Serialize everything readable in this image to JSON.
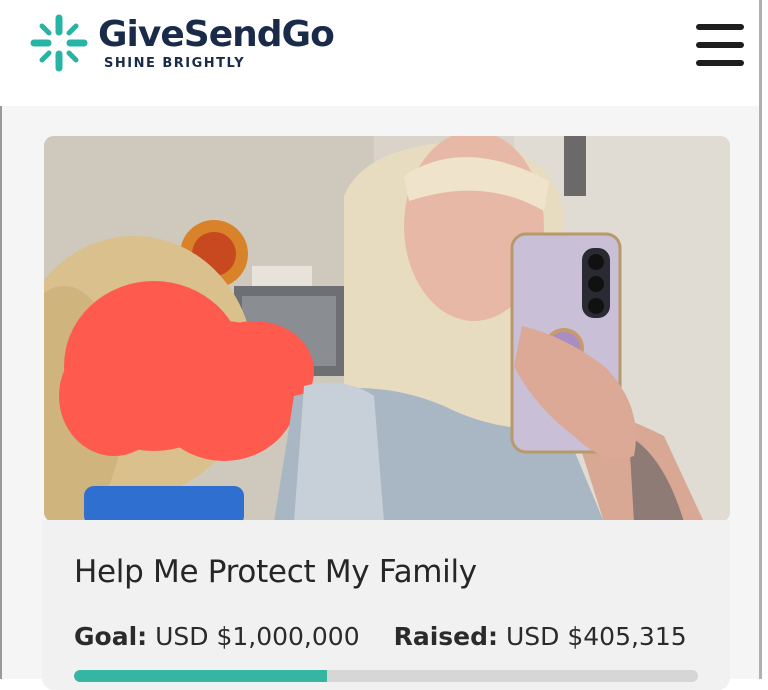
{
  "brand": {
    "name": "GiveSendGo",
    "tagline": "SHINE BRIGHTLY",
    "accent_color": "#27b4a5",
    "text_color": "#1a2b4a"
  },
  "header": {
    "menu_icon": "hamburger-menu-icon"
  },
  "campaign": {
    "title": "Help Me Protect My Family",
    "goal_label": "Goal:",
    "goal_value": "USD $1,000,000",
    "raised_label": "Raised:",
    "raised_value": "USD $405,315",
    "progress_fraction": 0.405315,
    "progress_color": "#35b6a3"
  }
}
